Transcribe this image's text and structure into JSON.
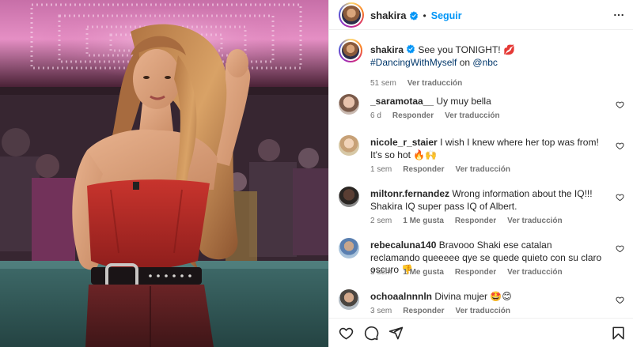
{
  "header": {
    "username": "shakira",
    "separator": "•",
    "follow_label": "Seguir"
  },
  "caption": {
    "username": "shakira",
    "text": "See you TONIGHT! 💋 ",
    "hashtag": "#DancingWithMyself",
    "text_after": " on ",
    "mention": "@nbc",
    "time": "51 sem",
    "translate": "Ver traducción"
  },
  "comments": [
    {
      "username": "_saramotaa__",
      "text": "Uy muy bella",
      "time": "6 d",
      "likes": "",
      "reply": "Responder",
      "translate": "Ver traducción"
    },
    {
      "username": "nicole_r_staier",
      "text": "I wish I knew where her top was from! It's so hot 🔥🙌",
      "time": "1 sem",
      "likes": "",
      "reply": "Responder",
      "translate": "Ver traducción"
    },
    {
      "username": "miltonr.fernandez",
      "text": "Wrong information about the IQ!!! Shakira IQ super pass IQ of Albert.",
      "time": "2 sem",
      "likes": "1 Me gusta",
      "reply": "Responder",
      "translate": "Ver traducción"
    },
    {
      "username": "rebecaluna140",
      "text": "Bravooo Shaki ese catalan reclamando queeeee qye se quede quieto con su claro oscuro 👎",
      "time": "3 sem",
      "likes": "1 Me gusta",
      "reply": "Responder",
      "translate": "Ver traducción"
    },
    {
      "username": "ochoaalnnnln",
      "text": "Divina mujer 🤩😊",
      "time": "3 sem",
      "likes": "",
      "reply": "Responder",
      "translate": "Ver traducción"
    }
  ],
  "icons": {
    "more": "more-options-icon",
    "verified": "verified-badge-icon",
    "like": "heart-icon",
    "comment": "comment-icon",
    "share": "share-icon",
    "save": "bookmark-icon"
  },
  "colors": {
    "accent": "#0095f6",
    "verified": "#0095f6",
    "link": "#00376b",
    "muted": "#737373",
    "text": "#262626"
  }
}
